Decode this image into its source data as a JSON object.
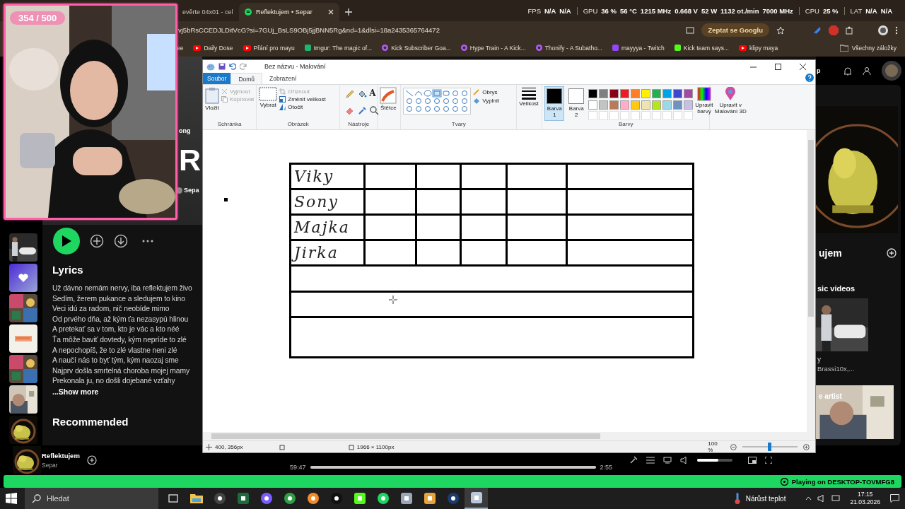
{
  "browser": {
    "tabs": [
      {
        "label": "evěrte 04x01 - cel",
        "selected": false
      },
      {
        "label": "Reflektujem • Separ",
        "selected": true
      }
    ],
    "stats": [
      {
        "label": "FPS",
        "values": [
          "N/A",
          "N/A"
        ]
      },
      {
        "label": "GPU",
        "values": [
          "36 %",
          "56 °C",
          "1215 MHz",
          "0.668 V",
          "52 W",
          "1132 ot./min",
          "7000 MHz"
        ]
      },
      {
        "label": "CPU",
        "values": [
          "25 %"
        ]
      },
      {
        "label": "LAT",
        "values": [
          "N/A",
          "N/A"
        ]
      }
    ],
    "url": "vj5bRsCCEDJLDitVcG?si=7GUj_BsLS9OBj5jjBNN5Rg&nd=1&dlsi=18a2435365764472",
    "ask_button": "Zeptat se Googlu",
    "bookmarks": [
      {
        "label": "ee",
        "kind": "none"
      },
      {
        "label": "Daily Dose",
        "kind": "play",
        "color": "#ff0000"
      },
      {
        "label": "Přání pro mayu",
        "kind": "play",
        "color": "#ff0000"
      },
      {
        "label": "Imgur: The magic of...",
        "kind": "square",
        "color": "#1bb76e"
      },
      {
        "label": "Kick Subscriber Goa...",
        "kind": "circle",
        "color": "#b05cff"
      },
      {
        "label": "Hype Train - A Kick...",
        "kind": "circle",
        "color": "#b05cff"
      },
      {
        "label": "Thonify - A Subatho...",
        "kind": "circle",
        "color": "#b05cff"
      },
      {
        "label": "mayyya - Twitch",
        "kind": "square",
        "color": "#9146ff"
      },
      {
        "label": "Kick team says...",
        "kind": "square",
        "color": "#53fc18"
      },
      {
        "label": "klipy maya",
        "kind": "play",
        "color": "#ff0000"
      }
    ],
    "all_bookmarks": "Všechny záložky"
  },
  "webcam": {
    "counter": "354 / 500"
  },
  "spotify": {
    "header": {
      "label": "ong",
      "title": "R",
      "artist": "Sepa"
    },
    "library": [
      {
        "kind": "picture"
      },
      {
        "kind": "liked"
      },
      {
        "kind": "picture"
      },
      {
        "kind": "picture"
      },
      {
        "kind": "picture"
      },
      {
        "kind": "picture"
      },
      {
        "kind": "picture"
      }
    ],
    "lyrics": {
      "title": "Lyrics",
      "lines": [
        "Už dávno nemám nervy, iba reflektujem živo",
        "Sedím, žerem pukance a sledujem to kino",
        "Veci idú za radom, nič neobíde mimo",
        "Od prvého dňa, až kým ťa nezasypú hlinou",
        "A pretekať sa v tom, kto je vác a kto néé",
        "Ťa môže baviť dovtedy, kým nepríde to zlé",
        "A nepochopíš, že to zlé vlastne neni zlé",
        "A naučí nás to byť tým, kým naozaj sme",
        "Najprv došla smrtelná choroba mojej mamy",
        "Prekonala ju, no došli dojebané vzťahy"
      ],
      "more": "...Show more"
    },
    "recommended": "Recommended",
    "right": {
      "install": "p",
      "card_title": "ujem",
      "videos": "sic videos",
      "video_title": "y",
      "video_artists": "Brassi10x,...",
      "artist_label": "e artist"
    },
    "player": {
      "title": "Reflektujem",
      "artist": "Separ",
      "elapsed": "59:47",
      "duration": "2:55",
      "level": 1,
      "volume": {
        "level": 0.6
      }
    },
    "device": "Playing on DESKTOP-TOVMFG8"
  },
  "paint": {
    "title": "Bez názvu - Malování",
    "tabs": [
      {
        "label": "Soubor",
        "kind": "file",
        "selected": false
      },
      {
        "label": "Domů",
        "kind": "tab",
        "selected": true
      },
      {
        "label": "Zobrazení",
        "kind": "tab",
        "selected": false
      }
    ],
    "clipboard": {
      "title": "Schránka",
      "paste": "Vložit",
      "cut": {
        "label": "Vyjmout",
        "disabled": true
      },
      "copy": {
        "label": "Kopírovat",
        "disabled": true
      }
    },
    "image": {
      "title": "Obrázek",
      "select": "Vybrat",
      "crop": {
        "label": "Oříznout",
        "disabled": true
      },
      "resize": {
        "label": "Změnit velikost",
        "disabled": false
      },
      "rotate": {
        "label": "Otočit",
        "disabled": false
      }
    },
    "tools": {
      "title": "Nástroje",
      "text_tool": "A"
    },
    "brushes": "Štětce",
    "shapes": {
      "title": "Tvary",
      "outline": "Obrys",
      "fill": "Vyplnit"
    },
    "size": "Velikost",
    "color1": {
      "label": "Barva 1",
      "selected": true,
      "color": "#000000"
    },
    "color2": {
      "label": "Barva 2",
      "selected": false,
      "color": "#ffffff"
    },
    "colors": {
      "title": "Barvy",
      "palette": [
        {
          "color": "#000000"
        },
        {
          "color": "#7f7f7f"
        },
        {
          "color": "#880015"
        },
        {
          "color": "#ed1c24"
        },
        {
          "color": "#ff7f27"
        },
        {
          "color": "#fff200"
        },
        {
          "color": "#22b14c"
        },
        {
          "color": "#00a2e8"
        },
        {
          "color": "#3f48cc"
        },
        {
          "color": "#a349a4"
        },
        {
          "color": "#ffffff"
        },
        {
          "color": "#c3c3c3"
        },
        {
          "color": "#b97a57"
        },
        {
          "color": "#ffaec9"
        },
        {
          "color": "#ffc90e"
        },
        {
          "color": "#efe4b0"
        },
        {
          "color": "#b5e61d"
        },
        {
          "color": "#99d9ea"
        },
        {
          "color": "#7092be"
        },
        {
          "color": "#c8bfe7"
        }
      ]
    },
    "edit_colors": "Upravit barvy",
    "paint3d": "Upravit v Malování 3D",
    "table": [
      {
        "kind": "named",
        "name": "Viky"
      },
      {
        "kind": "named",
        "name": "Sony"
      },
      {
        "kind": "named",
        "name": "Majka"
      },
      {
        "kind": "named",
        "name": "Jirka"
      },
      {
        "kind": "blank"
      },
      {
        "kind": "blank"
      },
      {
        "kind": "blank"
      }
    ],
    "status": {
      "position": "400, 356px",
      "size": "1966 × 1100px",
      "zoom": {
        "reading": "100 %",
        "level": 0.48
      }
    }
  },
  "taskbar": {
    "search": "Hledat",
    "apps": [
      {
        "kind": "taskview",
        "selected": false
      },
      {
        "kind": "folder",
        "selected": false
      },
      {
        "kind": "circle",
        "color": "#444444",
        "selected": false
      },
      {
        "kind": "square",
        "color": "#1d6b3a",
        "selected": false
      },
      {
        "kind": "circle",
        "color": "#7a5cff",
        "selected": false
      },
      {
        "kind": "circle",
        "color": "#2f9e44",
        "selected": false
      },
      {
        "kind": "circle",
        "color": "#f28c28",
        "selected": false
      },
      {
        "kind": "circle",
        "color": "#111111",
        "selected": false
      },
      {
        "kind": "square",
        "color": "#53fc18",
        "selected": false
      },
      {
        "kind": "circle",
        "color": "#1ed760",
        "selected": false
      },
      {
        "kind": "square",
        "color": "#9aa7b8",
        "selected": false
      },
      {
        "kind": "square",
        "color": "#e7a23b",
        "selected": false
      },
      {
        "kind": "circle",
        "color": "#1b3d6d",
        "selected": false
      },
      {
        "kind": "square",
        "color": "#b8c7d9",
        "selected": true
      }
    ],
    "weather": "Nárůst teplot",
    "time": "17:15",
    "date": "21.03.2026"
  }
}
